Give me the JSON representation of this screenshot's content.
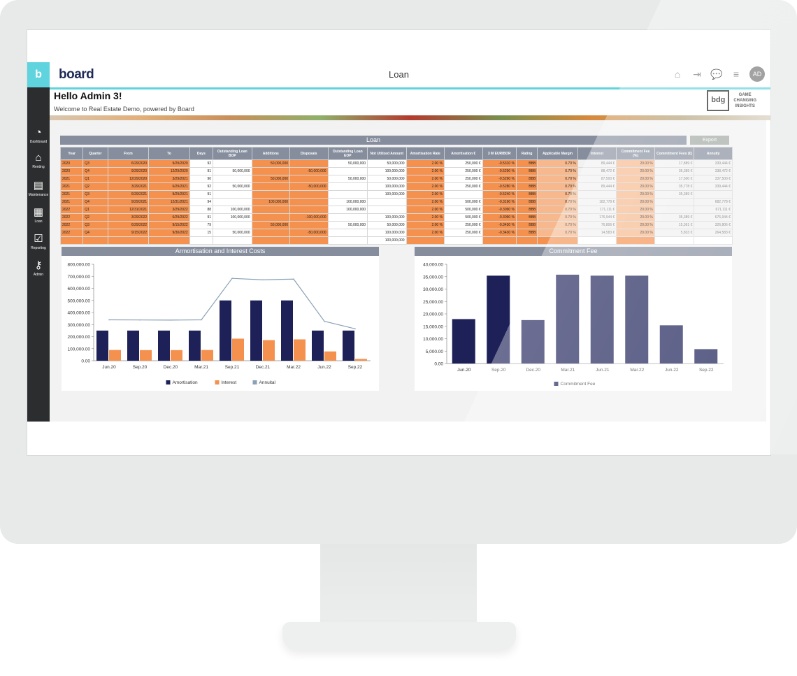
{
  "app": {
    "logo_letter": "b",
    "brand": "board",
    "screen_title": "Loan"
  },
  "topbar_icons": [
    {
      "name": "home-icon",
      "glyph": "⌂"
    },
    {
      "name": "logout-icon",
      "glyph": "⇥"
    },
    {
      "name": "chat-icon",
      "glyph": "💬"
    },
    {
      "name": "menu-icon",
      "glyph": "≡"
    }
  ],
  "user": {
    "initials": "AD"
  },
  "greeting": {
    "title": "Hello Admin 3!",
    "subtitle": "Welcome to Real Estate Demo, powered by Board"
  },
  "partner": {
    "logo_text": "bdg",
    "tagline": [
      "GAME",
      "CHANGING",
      "INSIGHTS"
    ]
  },
  "sidebar": {
    "items": [
      {
        "label": "Dashboard",
        "icon": "dashboard-gauge-icon"
      },
      {
        "label": "Renting",
        "icon": "home-icon"
      },
      {
        "label": "Maintenance",
        "icon": "document-icon"
      },
      {
        "label": "Loan",
        "icon": "loan-document-icon"
      },
      {
        "label": "Reporting",
        "icon": "checkbox-icon"
      },
      {
        "label": "Admin",
        "icon": "key-icon"
      }
    ]
  },
  "loan_section": {
    "title": "Loan",
    "export_label": "Export"
  },
  "table": {
    "headers": [
      "Year",
      "Quarter",
      "From",
      "To",
      "Days",
      "Outstanding Loan BOP",
      "Additions",
      "Disposals",
      "Outstanding Loan EOP",
      "Not Utilized Amount",
      "Amortisation Rate",
      "Amortisation €",
      "3 M EURIBOR",
      "Rating",
      "Applicable Margin",
      "Interest",
      "Commitment Fee (%)",
      "Commitment Fees (€)",
      "Annuity"
    ],
    "rows": [
      [
        "2020",
        "Q3",
        "6/29/2020",
        "9/29/2020",
        "92",
        "",
        "50,000,000",
        "",
        "50,000,000",
        "50,000,000",
        "2.00 %",
        "250,000 €",
        "-0.5310 %",
        "BBB",
        "0.70 %",
        "89,444 €",
        "20.00 %",
        "17,889 €",
        "339,444 €"
      ],
      [
        "2020",
        "Q4",
        "9/29/2020",
        "12/29/2020",
        "91",
        "50,000,000",
        "",
        "-50,000,000",
        "",
        "100,000,000",
        "2.00 %",
        "250,000 €",
        "-0.5290 %",
        "BBB",
        "0.70 %",
        "88,472 €",
        "20.00 %",
        "35,389 €",
        "338,472 €"
      ],
      [
        "2021",
        "Q1",
        "12/29/2020",
        "3/29/2021",
        "90",
        "",
        "50,000,000",
        "",
        "50,000,000",
        "50,000,000",
        "2.00 %",
        "250,000 €",
        "-0.5290 %",
        "BBB",
        "0.70 %",
        "87,500 €",
        "20.00 %",
        "17,500 €",
        "337,500 €"
      ],
      [
        "2021",
        "Q2",
        "3/29/2021",
        "6/29/2021",
        "92",
        "50,000,000",
        "",
        "-50,000,000",
        "",
        "100,000,000",
        "2.00 %",
        "250,000 €",
        "-0.5280 %",
        "BBB",
        "0.70 %",
        "89,444 €",
        "20.00 %",
        "35,778 €",
        "339,444 €"
      ],
      [
        "2021",
        "Q3",
        "6/29/2021",
        "9/29/2021",
        "91",
        "",
        "",
        "",
        "",
        "100,000,000",
        "2.00 %",
        "",
        "-0.5240 %",
        "BBB",
        "0.70 %",
        "",
        "20.00 %",
        "35,389 €",
        ""
      ],
      [
        "2021",
        "Q4",
        "9/29/2021",
        "12/31/2021",
        "94",
        "",
        "100,000,000",
        "",
        "100,000,000",
        "",
        "2.00 %",
        "500,000 €",
        "-0.3190 %",
        "BBB",
        "0.70 %",
        "182,778 €",
        "20.00 %",
        "",
        "682,778 €"
      ],
      [
        "2022",
        "Q1",
        "12/31/2021",
        "3/29/2022",
        "88",
        "100,000,000",
        "",
        "",
        "100,000,000",
        "",
        "2.00 %",
        "500,000 €",
        "-0.3090 %",
        "BBB",
        "0.70 %",
        "171,111 €",
        "20.00 %",
        "",
        "671,111 €"
      ],
      [
        "2022",
        "Q2",
        "3/29/2022",
        "6/29/2022",
        "91",
        "100,000,000",
        "",
        "-100,000,000",
        "",
        "100,000,000",
        "2.00 %",
        "500,000 €",
        "-0.3090 %",
        "BBB",
        "0.70 %",
        "176,944 €",
        "20.00 %",
        "35,389 €",
        "676,944 €"
      ],
      [
        "2022",
        "Q3",
        "6/29/2022",
        "9/15/2022",
        "79",
        "",
        "50,000,000",
        "",
        "50,000,000",
        "50,000,000",
        "2.00 %",
        "250,000 €",
        "-0.3430 %",
        "BBB",
        "0.70 %",
        "76,806 €",
        "20.00 %",
        "15,361 €",
        "326,806 €"
      ],
      [
        "2022",
        "Q4",
        "9/15/2022",
        "9/30/2022",
        "15",
        "50,000,000",
        "",
        "-50,000,000",
        "",
        "100,000,000",
        "2.00 %",
        "250,000 €",
        "-0.3430 %",
        "BBB",
        "0.70 %",
        "14,583 €",
        "20.00 %",
        "5,833 €",
        "264,583 €"
      ],
      [
        "",
        "",
        "",
        "",
        "",
        "",
        "",
        "",
        "",
        "100,000,000",
        "",
        "",
        "",
        "",
        "",
        "",
        "",
        "",
        ""
      ]
    ]
  },
  "colors": {
    "accent": "#5fd3de",
    "navy": "#1d2158",
    "orange": "#f4914e",
    "header_gray": "#868e9e",
    "annuity_line": "#8aa1b6"
  },
  "chart_data": [
    {
      "type": "bar",
      "title": "Armortisation and Interest Costs",
      "categories": [
        "Jun.20",
        "Sep.20",
        "Dec.20",
        "Mar.21",
        "Sep.21",
        "Dec.21",
        "Mar.22",
        "Jun.22",
        "Sep.22"
      ],
      "series": [
        {
          "name": "Amortisation",
          "type": "bar",
          "color": "#1d2158",
          "values": [
            250000,
            250000,
            250000,
            250000,
            500000,
            500000,
            500000,
            250000,
            250000
          ]
        },
        {
          "name": "Interest",
          "type": "bar",
          "color": "#f4914e",
          "values": [
            89000,
            88000,
            88000,
            89000,
            183000,
            171000,
            177000,
            77000,
            15000
          ]
        },
        {
          "name": "Annuital",
          "type": "line",
          "color": "#8aa1b6",
          "values": [
            339000,
            338000,
            337000,
            339000,
            683000,
            671000,
            677000,
            327000,
            265000
          ]
        }
      ],
      "ylim": [
        0,
        800000
      ],
      "yticks": [
        "0.00",
        "100,000.00",
        "200,000.00",
        "300,000.00",
        "400,000.00",
        "500,000.00",
        "600,000.00",
        "700,000.00",
        "800,000.00"
      ],
      "legend": "bottom"
    },
    {
      "type": "bar",
      "title": "Commitment Fee",
      "categories": [
        "Jun.20",
        "Sep.20",
        "Dec.20",
        "Mar.21",
        "Jun.21",
        "Mar.22",
        "Jun.22",
        "Sep.22"
      ],
      "series": [
        {
          "name": "Commitment Fee",
          "color": "#1d2158",
          "values": [
            17900,
            35400,
            17500,
            35800,
            35400,
            35400,
            15400,
            5800
          ]
        }
      ],
      "ylim": [
        0,
        40000
      ],
      "yticks": [
        "0.00",
        "5,000.00",
        "10,000.00",
        "15,000.00",
        "20,000.00",
        "25,000.00",
        "30,000.00",
        "35,000.00",
        "40,000.00"
      ],
      "legend": "bottom"
    }
  ]
}
